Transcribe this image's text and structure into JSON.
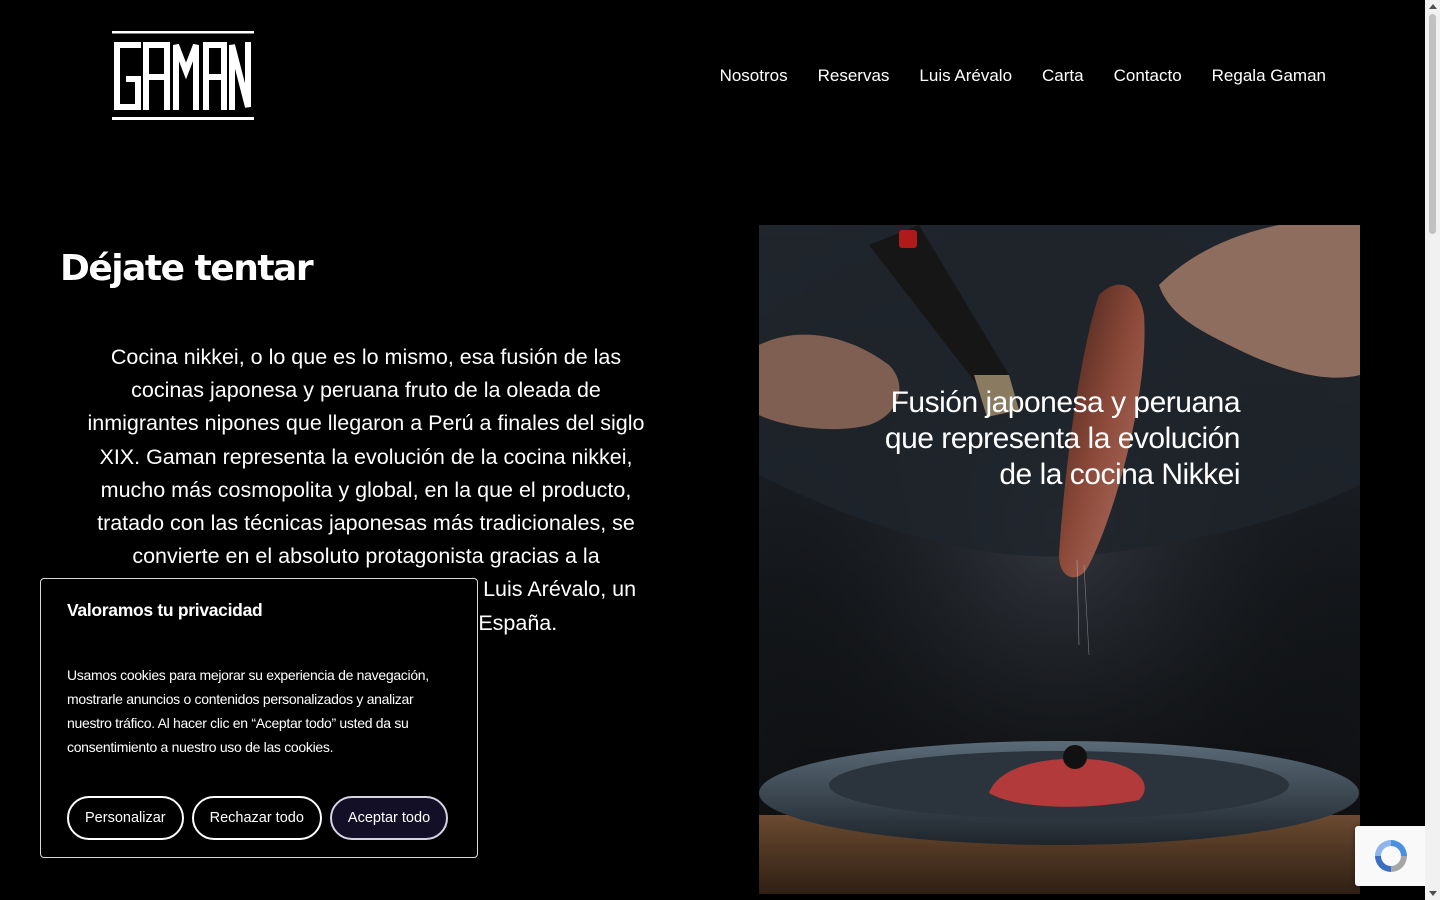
{
  "brand": {
    "logo_text": "GAMAN"
  },
  "nav": {
    "items": [
      {
        "label": "Nosotros"
      },
      {
        "label": "Reservas"
      },
      {
        "label": "Luis Arévalo"
      },
      {
        "label": "Carta"
      },
      {
        "label": "Contacto"
      },
      {
        "label": "Regala Gaman"
      }
    ]
  },
  "main": {
    "title": "Déjate tentar",
    "intro": "Cocina nikkei, o lo que es lo mismo, esa fusión de las cocinas japonesa y peruana fruto de la oleada de inmigrantes nipones que llegaron a Perú a finales del siglo XIX. Gaman representa la evolución de la cocina nikkei, mucho más cosmopolita y global, en la que el producto, tratado con las técnicas japonesas más tradicionales, se convierte en el absoluto protagonista gracias a la creatividad y visión personal de su chef, Luis Arévalo, un referente de la cocina nikkei en España."
  },
  "hero": {
    "caption": "Fusión japonesa y peruana que representa la evolución de la cocina Nikkei"
  },
  "cookie_banner": {
    "title": "Valoramos tu privacidad",
    "text": "Usamos cookies para mejorar su experiencia de navegación, mostrarle anuncios o contenidos personalizados y analizar nuestro tráfico. Al hacer clic en “Aceptar todo” usted da su consentimiento a nuestro uso de las cookies.",
    "customize_label": "Personalizar",
    "reject_label": "Rechazar todo",
    "accept_label": "Aceptar todo"
  },
  "colors": {
    "background": "#000000",
    "text": "#ffffff",
    "accept_button_bg": "#130f26"
  }
}
